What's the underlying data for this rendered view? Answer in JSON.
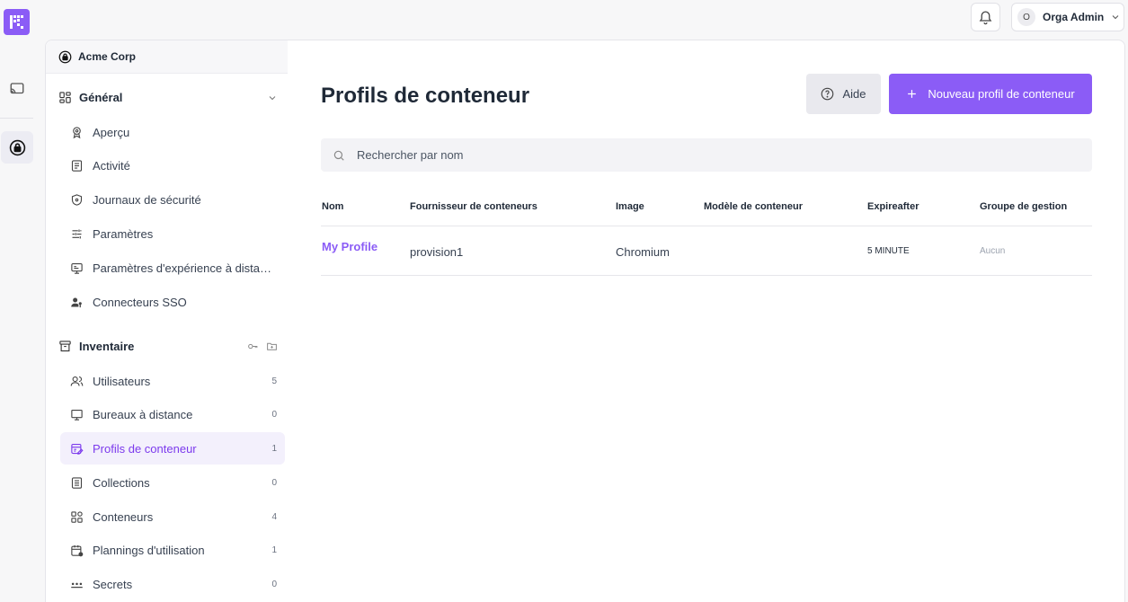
{
  "org": {
    "name": "Acme Corp"
  },
  "topbar": {
    "user_initial": "O",
    "user_name": "Orga Admin"
  },
  "sidebar": {
    "general": {
      "title": "Général",
      "items": [
        {
          "label": "Aperçu",
          "icon": "award-icon"
        },
        {
          "label": "Activité",
          "icon": "document-icon"
        },
        {
          "label": "Journaux de sécurité",
          "icon": "shield-icon"
        },
        {
          "label": "Paramètres",
          "icon": "sliders-icon"
        },
        {
          "label": "Paramètres d'expérience à distance",
          "icon": "remote-screen-icon"
        },
        {
          "label": "Connecteurs SSO",
          "icon": "user-key-icon"
        }
      ]
    },
    "inventory": {
      "title": "Inventaire",
      "items": [
        {
          "label": "Utilisateurs",
          "count": "5",
          "icon": "users-icon"
        },
        {
          "label": "Bureaux à distance",
          "count": "0",
          "icon": "monitor-icon"
        },
        {
          "label": "Profils de conteneur",
          "count": "1",
          "icon": "container-profile-icon"
        },
        {
          "label": "Collections",
          "count": "0",
          "icon": "collection-icon"
        },
        {
          "label": "Conteneurs",
          "count": "4",
          "icon": "grid-icon"
        },
        {
          "label": "Plannings d'utilisation",
          "count": "1",
          "icon": "calendar-icon"
        },
        {
          "label": "Secrets",
          "count": "0",
          "icon": "password-icon"
        }
      ]
    }
  },
  "main": {
    "title": "Profils de conteneur",
    "help_label": "Aide",
    "new_label": "Nouveau profil de conteneur",
    "search_placeholder": "Rechercher par nom",
    "table": {
      "headers": [
        "Nom",
        "Fournisseur de conteneurs",
        "Image",
        "Modèle de conteneur",
        "Expireafter",
        "Groupe de gestion"
      ],
      "rows": [
        {
          "name": "My Profile",
          "provider": "provision1",
          "image": "Chromium",
          "template": "",
          "expire": "5 MINUTE",
          "group": "Aucun"
        }
      ]
    }
  },
  "colors": {
    "accent": "#8b5cf6",
    "accent_text": "#7c3aed",
    "active_bg": "#f3f0fc"
  }
}
